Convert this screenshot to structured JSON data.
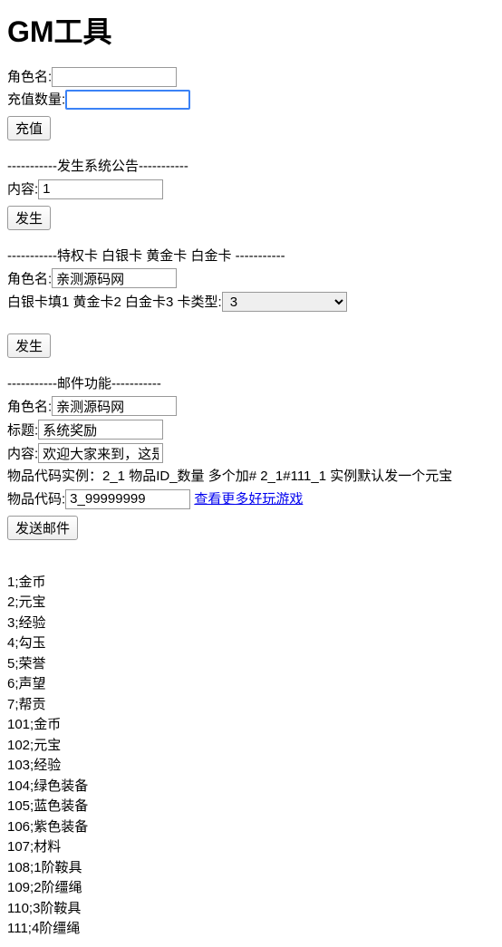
{
  "page_title": "GM工具",
  "recharge": {
    "role_label": "角色名:",
    "role_value": "",
    "amount_label": "充值数量:",
    "amount_value": "",
    "submit_label": "充值"
  },
  "announce": {
    "divider": "-----------发生系统公告-----------",
    "content_label": "内容:",
    "content_value": "1",
    "submit_label": "发生"
  },
  "cards": {
    "divider": "-----------特权卡 白银卡 黄金卡 白金卡 -----------",
    "role_label": "角色名:",
    "role_value": "亲测源码网",
    "card_type_label": "白银卡填1 黄金卡2 白金卡3 卡类型:",
    "card_type_value": "3",
    "submit_label": "发生"
  },
  "mail": {
    "divider": "-----------邮件功能-----------",
    "role_label": "角色名:",
    "role_value": "亲测源码网",
    "title_label": "标题:",
    "title_value": "系统奖励",
    "content_label": "内容:",
    "content_value": "欢迎大家来到，这是系统",
    "item_example": "物品代码实例：2_1 物品ID_数量 多个加# 2_1#111_1 实例默认发一个元宝",
    "item_code_label": "物品代码:",
    "item_code_value": "3_99999999",
    "more_games_link": "查看更多好玩游戏",
    "submit_label": "发送邮件"
  },
  "items": [
    "1;金币",
    "2;元宝",
    "3;经验",
    "4;勾玉",
    "5;荣誉",
    "6;声望",
    "7;帮贡",
    "101;金币",
    "102;元宝",
    "103;经验",
    "104;绿色装备",
    "105;蓝色装备",
    "106;紫色装备",
    "107;材料",
    "108;1阶鞍具",
    "109;2阶缰绳",
    "110;3阶鞍具",
    "111;4阶缰绳"
  ]
}
